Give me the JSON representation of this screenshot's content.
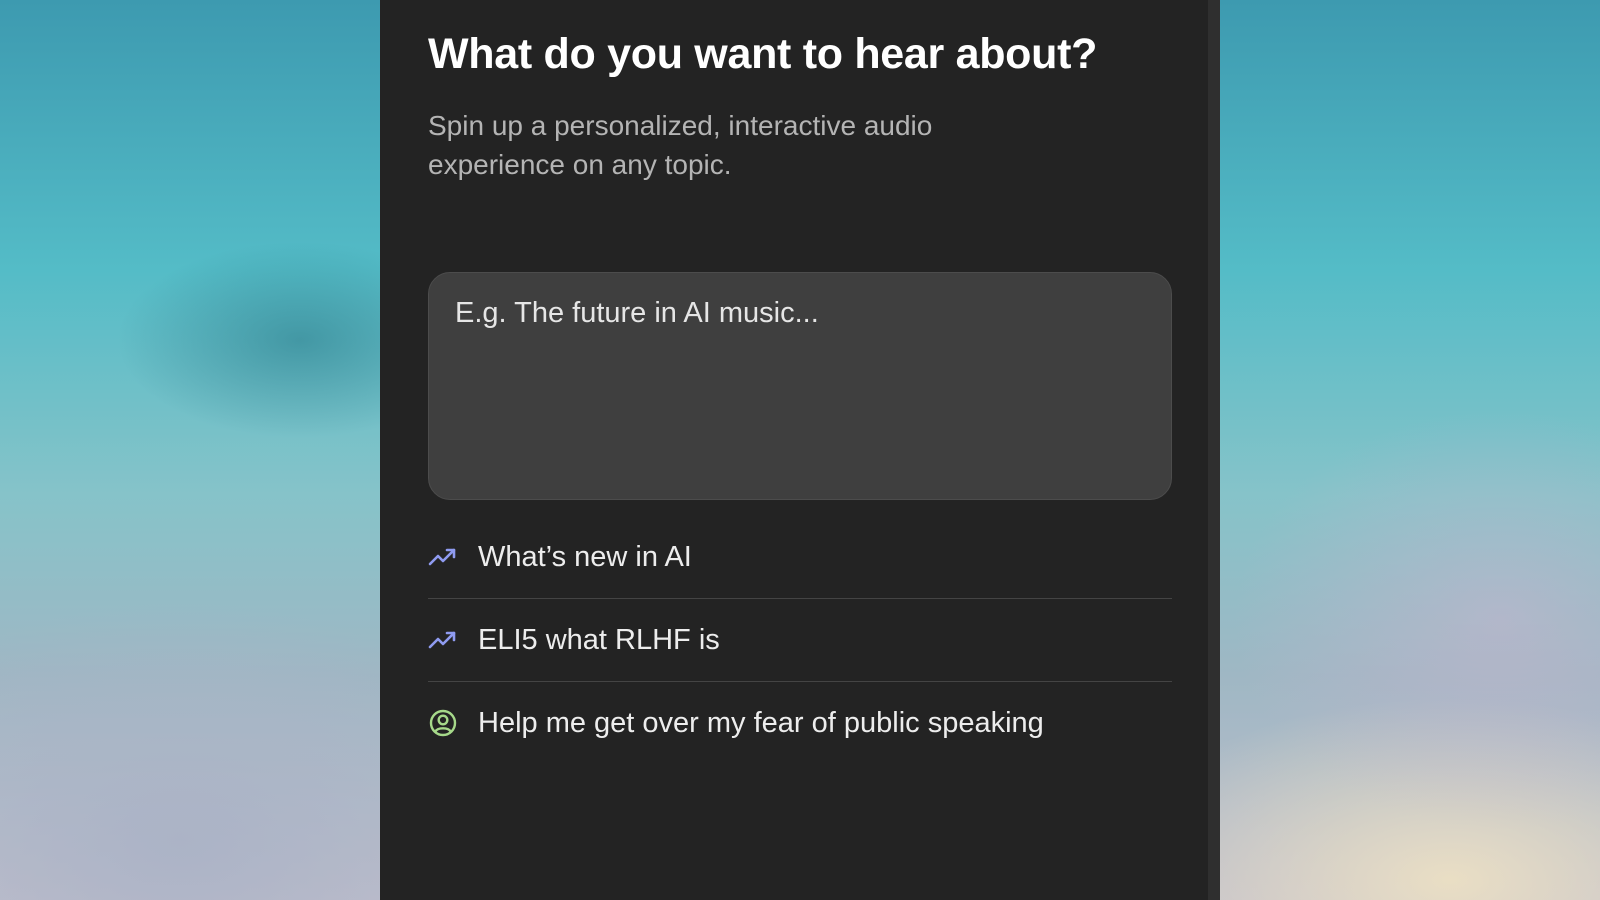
{
  "header": {
    "title": "What do you want to hear about?",
    "subtitle": "Spin up a personalized, interactive audio experience on any topic."
  },
  "topic_input": {
    "placeholder": "E.g. The future in AI music...",
    "value": ""
  },
  "suggestions": [
    {
      "label": "What’s new in AI",
      "icon": "trending-up-icon",
      "icon_color": "#8f9bf0"
    },
    {
      "label": "ELI5 what RLHF is",
      "icon": "trending-up-icon",
      "icon_color": "#8f9bf0"
    },
    {
      "label": "Help me get over my fear of public speaking",
      "icon": "person-circle-icon",
      "icon_color": "#a6d98a"
    }
  ],
  "colors": {
    "panel_background": "#232323",
    "input_background": "#3f3f3f",
    "title_text": "#ffffff",
    "subtitle_text": "#b4b4b4"
  }
}
